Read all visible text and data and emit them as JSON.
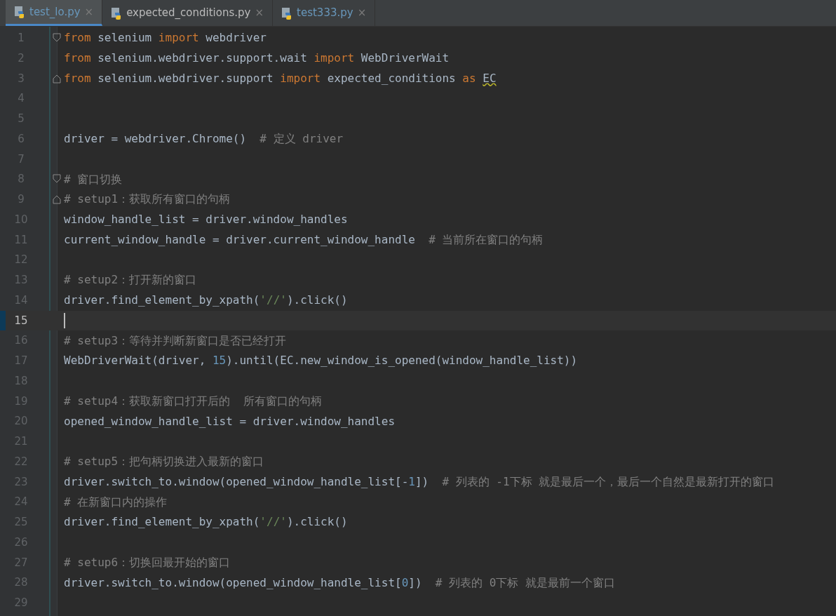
{
  "tabs": [
    {
      "label": "test_lo.py",
      "selected": true,
      "modified": true,
      "close": "×"
    },
    {
      "label": "expected_conditions.py",
      "selected": false,
      "modified": false,
      "close": "×"
    },
    {
      "label": "test333.py",
      "selected": false,
      "modified": true,
      "close": "×"
    }
  ],
  "lines": [
    {
      "number": "1",
      "fold_start": true,
      "fold_end": false,
      "current": false,
      "tokens": [
        {
          "kind": "kw",
          "text": "from"
        },
        {
          "kind": "plain",
          "text": " selenium "
        },
        {
          "kind": "kw",
          "text": "import"
        },
        {
          "kind": "plain",
          "text": " webdriver"
        }
      ]
    },
    {
      "number": "2",
      "fold_start": false,
      "fold_end": false,
      "current": false,
      "tokens": [
        {
          "kind": "kw",
          "text": "from"
        },
        {
          "kind": "plain",
          "text": " selenium.webdriver.support.wait "
        },
        {
          "kind": "kw",
          "text": "import"
        },
        {
          "kind": "plain",
          "text": " WebDriverWait"
        }
      ]
    },
    {
      "number": "3",
      "fold_start": false,
      "fold_end": true,
      "current": false,
      "tokens": [
        {
          "kind": "kw",
          "text": "from"
        },
        {
          "kind": "plain",
          "text": " selenium.webdriver.support "
        },
        {
          "kind": "kw",
          "text": "import"
        },
        {
          "kind": "plain",
          "text": " expected_conditions "
        },
        {
          "kind": "kw",
          "text": "as "
        },
        {
          "kind": "warn",
          "text": "EC"
        }
      ]
    },
    {
      "number": "4",
      "fold_start": false,
      "fold_end": false,
      "current": false
    },
    {
      "number": "5",
      "fold_start": false,
      "fold_end": false,
      "current": false
    },
    {
      "number": "6",
      "fold_start": false,
      "fold_end": false,
      "current": false,
      "tokens": [
        {
          "kind": "plain",
          "text": "driver = webdriver.Chrome()  "
        },
        {
          "kind": "comment",
          "text": "# 定义 driver"
        }
      ]
    },
    {
      "number": "7",
      "fold_start": false,
      "fold_end": false,
      "current": false
    },
    {
      "number": "8",
      "fold_start": true,
      "fold_end": false,
      "current": false,
      "tokens": [
        {
          "kind": "comment",
          "text": "# 窗口切换"
        }
      ]
    },
    {
      "number": "9",
      "fold_start": false,
      "fold_end": true,
      "current": false,
      "tokens": [
        {
          "kind": "comment",
          "text": "# setup1：获取所有窗口的句柄"
        }
      ]
    },
    {
      "number": "10",
      "fold_start": false,
      "fold_end": false,
      "current": false,
      "tokens": [
        {
          "kind": "plain",
          "text": "window_handle_list = driver.window_handles"
        }
      ]
    },
    {
      "number": "11",
      "fold_start": false,
      "fold_end": false,
      "current": false,
      "tokens": [
        {
          "kind": "plain",
          "text": "current_window_handle = driver.current_window_handle  "
        },
        {
          "kind": "comment",
          "text": "# 当前所在窗口的句柄"
        }
      ]
    },
    {
      "number": "12",
      "fold_start": false,
      "fold_end": false,
      "current": false
    },
    {
      "number": "13",
      "fold_start": false,
      "fold_end": false,
      "current": false,
      "tokens": [
        {
          "kind": "comment",
          "text": "# setup2：打开新的窗口"
        }
      ]
    },
    {
      "number": "14",
      "fold_start": false,
      "fold_end": false,
      "current": false,
      "tokens": [
        {
          "kind": "plain",
          "text": "driver.find_element_by_xpath("
        },
        {
          "kind": "string",
          "text": "'//'"
        },
        {
          "kind": "plain",
          "text": ").click()"
        }
      ]
    },
    {
      "number": "15",
      "fold_start": false,
      "fold_end": false,
      "current": true
    },
    {
      "number": "16",
      "fold_start": false,
      "fold_end": false,
      "current": false,
      "tokens": [
        {
          "kind": "comment",
          "text": "# setup3：等待并判断新窗口是否已经打开"
        }
      ]
    },
    {
      "number": "17",
      "fold_start": false,
      "fold_end": false,
      "current": false,
      "tokens": [
        {
          "kind": "plain",
          "text": "WebDriverWait(driver, "
        },
        {
          "kind": "number",
          "text": "15"
        },
        {
          "kind": "plain",
          "text": ").until(EC.new_window_is_opened(window_handle_list))"
        }
      ]
    },
    {
      "number": "18",
      "fold_start": false,
      "fold_end": false,
      "current": false
    },
    {
      "number": "19",
      "fold_start": false,
      "fold_end": false,
      "current": false,
      "tokens": [
        {
          "kind": "comment",
          "text": "# setup4：获取新窗口打开后的  所有窗口的句柄"
        }
      ]
    },
    {
      "number": "20",
      "fold_start": false,
      "fold_end": false,
      "current": false,
      "tokens": [
        {
          "kind": "plain",
          "text": "opened_window_handle_list = driver.window_handles"
        }
      ]
    },
    {
      "number": "21",
      "fold_start": false,
      "fold_end": false,
      "current": false
    },
    {
      "number": "22",
      "fold_start": false,
      "fold_end": false,
      "current": false,
      "tokens": [
        {
          "kind": "comment",
          "text": "# setup5：把句柄切换进入最新的窗口"
        }
      ]
    },
    {
      "number": "23",
      "fold_start": false,
      "fold_end": false,
      "current": false,
      "tokens": [
        {
          "kind": "plain",
          "text": "driver.switch_to.window(opened_window_handle_list[-"
        },
        {
          "kind": "number",
          "text": "1"
        },
        {
          "kind": "plain",
          "text": "])  "
        },
        {
          "kind": "comment",
          "text": "# 列表的 -1下标 就是最后一个，最后一个自然是最新打开的窗口"
        }
      ]
    },
    {
      "number": "24",
      "fold_start": false,
      "fold_end": false,
      "current": false,
      "tokens": [
        {
          "kind": "comment",
          "text": "# 在新窗口内的操作"
        }
      ]
    },
    {
      "number": "25",
      "fold_start": false,
      "fold_end": false,
      "current": false,
      "tokens": [
        {
          "kind": "plain",
          "text": "driver.find_element_by_xpath("
        },
        {
          "kind": "string",
          "text": "'//'"
        },
        {
          "kind": "plain",
          "text": ").click()"
        }
      ]
    },
    {
      "number": "26",
      "fold_start": false,
      "fold_end": false,
      "current": false
    },
    {
      "number": "27",
      "fold_start": false,
      "fold_end": false,
      "current": false,
      "tokens": [
        {
          "kind": "comment",
          "text": "# setup6：切换回最开始的窗口"
        }
      ]
    },
    {
      "number": "28",
      "fold_start": false,
      "fold_end": false,
      "current": false,
      "tokens": [
        {
          "kind": "plain",
          "text": "driver.switch_to.window(opened_window_handle_list["
        },
        {
          "kind": "number",
          "text": "0"
        },
        {
          "kind": "plain",
          "text": "])  "
        },
        {
          "kind": "comment",
          "text": "# 列表的 0下标 就是最前一个窗口"
        }
      ]
    },
    {
      "number": "29",
      "fold_start": false,
      "fold_end": false,
      "current": false
    }
  ]
}
